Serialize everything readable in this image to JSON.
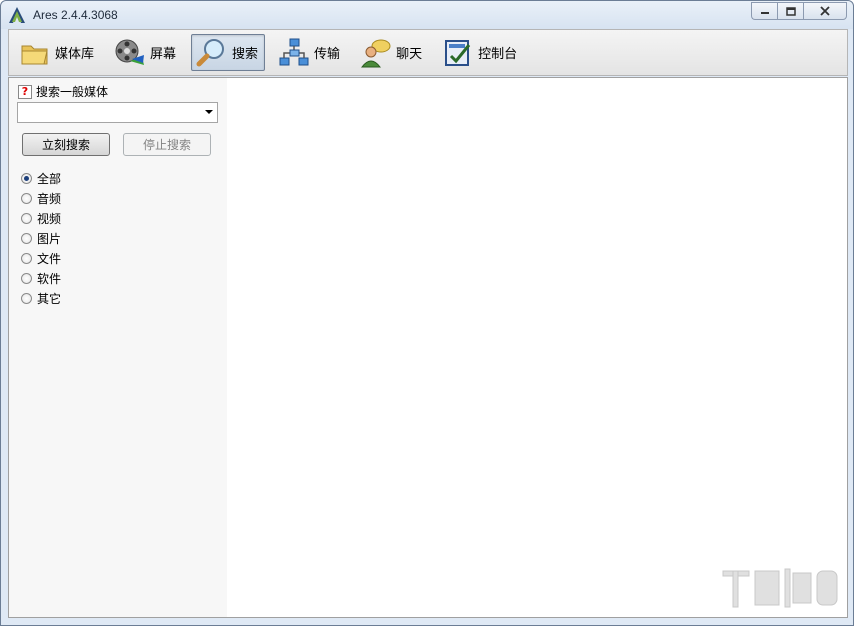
{
  "window": {
    "title": "Ares 2.4.4.3068",
    "app_icon": "ares-logo-icon",
    "controls": [
      "minimize-icon",
      "maximize-icon",
      "close-icon"
    ]
  },
  "toolbar": {
    "items": [
      {
        "label": "媒体库",
        "icon": "folder-icon",
        "active": false
      },
      {
        "label": "屏幕",
        "icon": "film-reel-icon",
        "active": false
      },
      {
        "label": "搜索",
        "icon": "magnifier-icon",
        "active": true
      },
      {
        "label": "传输",
        "icon": "network-icon",
        "active": false
      },
      {
        "label": "聊天",
        "icon": "chat-user-icon",
        "active": false
      },
      {
        "label": "控制台",
        "icon": "control-panel-icon",
        "active": false
      }
    ]
  },
  "search": {
    "help_icon": "help-icon",
    "label": "搜索一般媒体",
    "combo_value": "",
    "start_button": "立刻搜索",
    "stop_button": "停止搜索",
    "types": [
      {
        "label": "全部",
        "checked": true
      },
      {
        "label": "音频",
        "checked": false
      },
      {
        "label": "视频",
        "checked": false
      },
      {
        "label": "图片",
        "checked": false
      },
      {
        "label": "文件",
        "checked": false
      },
      {
        "label": "软件",
        "checked": false
      },
      {
        "label": "其它",
        "checked": false
      }
    ]
  },
  "colors": {
    "title_bg": "#dfe9f5",
    "active_tab_bg": "#c8d5e4",
    "panel_bg": "#f7f7f7"
  }
}
